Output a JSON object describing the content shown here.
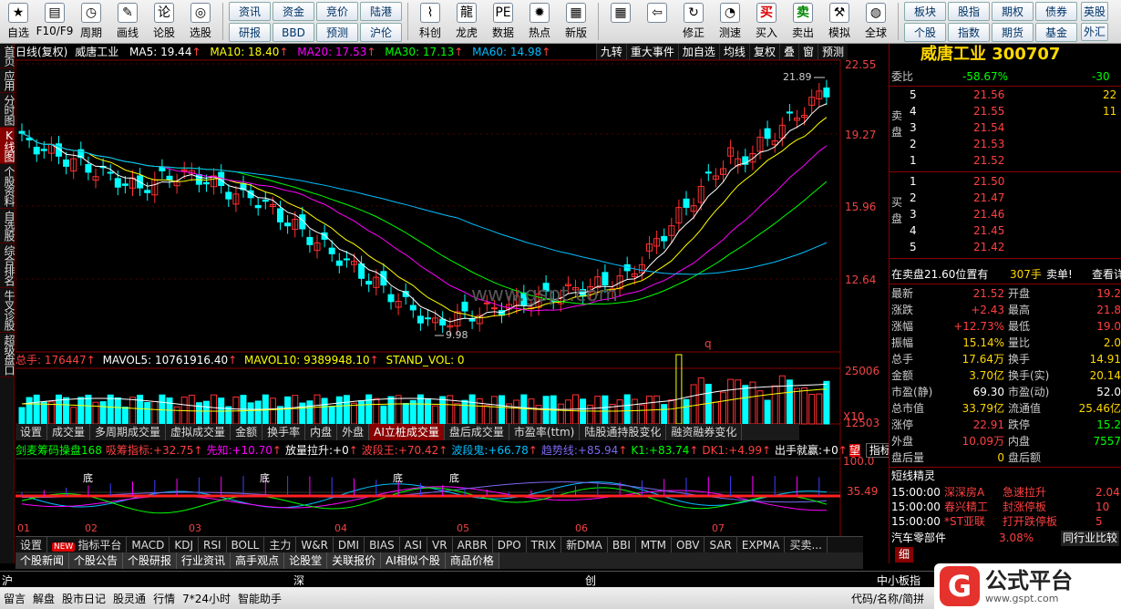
{
  "toolbar": {
    "left_buttons": [
      {
        "label": "自选",
        "icon": "star-icon"
      },
      {
        "label": "F10/F9",
        "icon": "f10-icon"
      },
      {
        "label": "周期",
        "icon": "clock-icon"
      },
      {
        "label": "画线",
        "icon": "pen-icon"
      },
      {
        "label": "论股",
        "icon": "discuss-icon",
        "glyph": "论"
      },
      {
        "label": "选股",
        "icon": "select-stock-icon"
      }
    ],
    "grid1": [
      "资讯",
      "资金",
      "竞价",
      "陆港",
      "研报",
      "BBD",
      "预测",
      "沪伦"
    ],
    "mid_buttons": [
      {
        "label": "科创",
        "icon": "kechuang-icon"
      },
      {
        "label": "龙虎",
        "icon": "dragon-tiger-icon"
      },
      {
        "label": "数据",
        "icon": "data-icon"
      },
      {
        "label": "热点",
        "icon": "hotspot-icon"
      },
      {
        "label": "新版",
        "icon": "new-version-icon"
      }
    ],
    "nav_buttons": [
      {
        "label": "",
        "icon": "grid-icon"
      },
      {
        "label": "",
        "icon": "back-arrow-icon"
      },
      {
        "label": "修正",
        "icon": "correct-icon"
      },
      {
        "label": "测速",
        "icon": "speed-test-icon"
      },
      {
        "label": "买入",
        "icon": "buy-icon",
        "glyph": "买"
      },
      {
        "label": "卖出",
        "icon": "sell-icon",
        "glyph": "卖"
      },
      {
        "label": "模拟",
        "icon": "hammer-icon"
      },
      {
        "label": "全球",
        "icon": "globe-icon"
      }
    ],
    "grid2": [
      "板块",
      "股指",
      "期权",
      "债券",
      "个股",
      "指数",
      "期货",
      "基金"
    ],
    "edge": [
      "英股",
      "外汇"
    ]
  },
  "left_tabs": [
    {
      "label": "首页",
      "active": false
    },
    {
      "label": "应用",
      "active": false
    },
    {
      "label": "分时图",
      "active": false
    },
    {
      "label": "K线图",
      "active": true
    },
    {
      "label": "个股资料",
      "active": false
    },
    {
      "label": "自选股",
      "active": false
    },
    {
      "label": "综合排名",
      "active": false
    },
    {
      "label": "牛叉诊股",
      "active": false
    },
    {
      "label": "超级盘口",
      "active": false
    }
  ],
  "price_header": {
    "title": "日线(复权)",
    "name": "威唐工业",
    "ma5": "MA5: 19.44",
    "ma10": "MA10: 18.40",
    "ma20": "MA20: 17.53",
    "ma30": "MA30: 17.13",
    "ma60": "MA60: 14.98",
    "colors": {
      "ma5": "#ffffff",
      "ma10": "#ffff00",
      "ma20": "#ff00ff",
      "ma30": "#00ff00",
      "ma60": "#00bfff"
    }
  },
  "top_tools": [
    "九转",
    "重大事件",
    "加自选",
    "均线",
    "复权",
    "叠",
    "窗",
    "预测"
  ],
  "price_axis": [
    "22.55",
    "19.27",
    "15.96",
    "12.64"
  ],
  "annotations": {
    "high": "21.89",
    "low": "9.98",
    "watermark": "www.gspt.com",
    "marker": "q"
  },
  "volume_header": {
    "total": "总手: 176447",
    "mavol5": "MAVOL5: 10761916.40",
    "mavol10": "MAVOL10: 9389948.10",
    "stand": "STAND_VOL: 0"
  },
  "volume_axis": [
    "25006",
    "12503",
    "X10"
  ],
  "sub_tabs": [
    {
      "label": "设置",
      "active": false
    },
    {
      "label": "成交量",
      "active": false
    },
    {
      "label": "多周期成交量",
      "active": false
    },
    {
      "label": "虚拟成交量",
      "active": false
    },
    {
      "label": "金额",
      "active": false
    },
    {
      "label": "换手率",
      "active": false
    },
    {
      "label": "内盘",
      "active": false
    },
    {
      "label": "外盘",
      "active": false
    },
    {
      "label": "AI立桩成交量",
      "active": true
    },
    {
      "label": "盘后成交量",
      "active": false
    },
    {
      "label": "市盈率(ttm)",
      "active": false
    },
    {
      "label": "陆股通持股变化",
      "active": false
    },
    {
      "label": "融资融券变化",
      "active": false
    }
  ],
  "indicator_header": {
    "name": "剑麦筹码操盘168",
    "items": [
      {
        "label": "吸筹指标:",
        "value": "+32.75",
        "color": "#ff4040"
      },
      {
        "label": "先知:",
        "value": "+10.70",
        "color": "#ff00ff"
      },
      {
        "label": "放量拉升:",
        "value": "+0",
        "color": "#ffffff"
      },
      {
        "label": "波段王:",
        "value": "+70.42",
        "color": "#ff4040"
      },
      {
        "label": "波段鬼:",
        "value": "+66.78",
        "color": "#00bfff"
      },
      {
        "label": "趋势线:",
        "value": "+85.94",
        "color": "#7b68ee"
      },
      {
        "label": "K1:",
        "value": "+83.74",
        "color": "#00ff00"
      },
      {
        "label": "DK1:",
        "value": "+4.99",
        "color": "#ff4040"
      },
      {
        "label": "出手就赢:",
        "value": "+0",
        "color": "#ffffff"
      }
    ],
    "tail_mark": "望",
    "explain": "指标说明"
  },
  "indicator_axis": [
    "100.0",
    "35.49"
  ],
  "bottom_labels": [
    "底",
    "底",
    "底",
    "底"
  ],
  "months": [
    "01",
    "02",
    "03",
    "04",
    "05",
    "06",
    "07"
  ],
  "indicator_tabs": [
    {
      "label": "设置",
      "new": false
    },
    {
      "label": "指标平台",
      "new": true,
      "badge": "NEW"
    },
    {
      "label": "MACD",
      "new": false
    },
    {
      "label": "KDJ",
      "new": false
    },
    {
      "label": "RSI",
      "new": false
    },
    {
      "label": "BOLL",
      "new": false
    },
    {
      "label": "主力",
      "new": false
    },
    {
      "label": "W&R",
      "new": false
    },
    {
      "label": "DMI",
      "new": false
    },
    {
      "label": "BIAS",
      "new": false
    },
    {
      "label": "ASI",
      "new": false
    },
    {
      "label": "VR",
      "new": false
    },
    {
      "label": "ARBR",
      "new": false
    },
    {
      "label": "DPO",
      "new": false
    },
    {
      "label": "TRIX",
      "new": false
    },
    {
      "label": "新DMA",
      "new": false
    },
    {
      "label": "BBI",
      "new": false
    },
    {
      "label": "MTM",
      "new": false
    },
    {
      "label": "OBV",
      "new": false
    },
    {
      "label": "SAR",
      "new": false
    },
    {
      "label": "EXPMA",
      "new": false
    },
    {
      "label": "买卖...",
      "new": false
    }
  ],
  "news_tabs": [
    "个股新闻",
    "个股公告",
    "个股研报",
    "行业资讯",
    "高手观点",
    "论股堂",
    "关联报价",
    "AI相似个股",
    "商品价格"
  ],
  "right_panel": {
    "title": "威唐工业 300707",
    "weibi_label": "委比",
    "weibi": "-58.67%",
    "weicha": "-30",
    "sell_label": "卖盘",
    "buy_label": "买盘",
    "sell": [
      {
        "lvl": "5",
        "price": "21.56",
        "vol": "22"
      },
      {
        "lvl": "4",
        "price": "21.55",
        "vol": "11"
      },
      {
        "lvl": "3",
        "price": "21.54",
        "vol": ""
      },
      {
        "lvl": "2",
        "price": "21.53",
        "vol": ""
      },
      {
        "lvl": "1",
        "price": "21.52",
        "vol": ""
      }
    ],
    "buy": [
      {
        "lvl": "1",
        "price": "21.50",
        "vol": ""
      },
      {
        "lvl": "2",
        "price": "21.47",
        "vol": ""
      },
      {
        "lvl": "3",
        "price": "21.46",
        "vol": ""
      },
      {
        "lvl": "4",
        "price": "21.45",
        "vol": ""
      },
      {
        "lvl": "5",
        "price": "21.42",
        "vol": ""
      }
    ],
    "pending": "在卖盘21.60位置有",
    "pending_vol": "307手",
    "pending_tag": "卖单!",
    "pending_link": "查看详细",
    "stats": [
      {
        "l1": "最新",
        "v1": "21.52",
        "c1": "red",
        "l2": "开盘",
        "v2": "19.2",
        "c2": "red"
      },
      {
        "l1": "涨跌",
        "v1": "+2.43",
        "c1": "red",
        "l2": "最高",
        "v2": "21.8",
        "c2": "red"
      },
      {
        "l1": "涨幅",
        "v1": "+12.73%",
        "c1": "red",
        "l2": "最低",
        "v2": "19.0",
        "c2": "red"
      },
      {
        "l1": "振幅",
        "v1": "15.14%",
        "c1": "yel",
        "l2": "量比",
        "v2": "2.0",
        "c2": "yel"
      },
      {
        "l1": "总手",
        "v1": "17.64万",
        "c1": "yel",
        "l2": "换手",
        "v2": "14.91",
        "c2": "yel"
      },
      {
        "l1": "金额",
        "v1": "3.70亿",
        "c1": "yel",
        "l2": "换手(实)",
        "v2": "20.14",
        "c2": "yel"
      },
      {
        "l1": "市盈(静)",
        "v1": "69.30",
        "c1": "wht",
        "l2": "市盈(动)",
        "v2": "52.0",
        "c2": "wht"
      },
      {
        "l1": "总市值",
        "v1": "33.79亿",
        "c1": "yel",
        "l2": "流通值",
        "v2": "25.46亿",
        "c2": "yel"
      },
      {
        "l1": "涨停",
        "v1": "22.91",
        "c1": "red",
        "l2": "跌停",
        "v2": "15.2",
        "c2": "grn"
      },
      {
        "l1": "外盘",
        "v1": "10.09万",
        "c1": "red",
        "l2": "内盘",
        "v2": "7557",
        "c2": "grn"
      },
      {
        "l1": "盘后量",
        "v1": "0",
        "c1": "yel",
        "l2": "盘后额",
        "v2": "",
        "c2": "yel"
      }
    ],
    "sprite_title": "短线精灵",
    "sprites": [
      {
        "time": "15:00:00",
        "name": "深深房A",
        "event": "急速拉升",
        "val": "2.04"
      },
      {
        "time": "15:00:00",
        "name": "春兴精工",
        "event": "封涨停板",
        "val": "10"
      },
      {
        "time": "15:00:00",
        "name": "*ST亚联",
        "event": "打开跌停板",
        "val": "5"
      }
    ],
    "sector": "汽车零部件",
    "sector_pct": "3.08%",
    "compare": "同行业比较",
    "detail_tab": "细",
    "mid_tab": "中小板指"
  },
  "bottom_bar1": [
    "沪",
    "深",
    "创"
  ],
  "bottom_bar2": [
    "留言",
    "解盘",
    "股市日记",
    "股灵通",
    "行情",
    "7*24小时",
    "智能助手"
  ],
  "bottom_right": "代码/名称/简拼",
  "logo": {
    "glyph": "G",
    "text": "公式平台",
    "url": "www.gspt.com"
  }
}
